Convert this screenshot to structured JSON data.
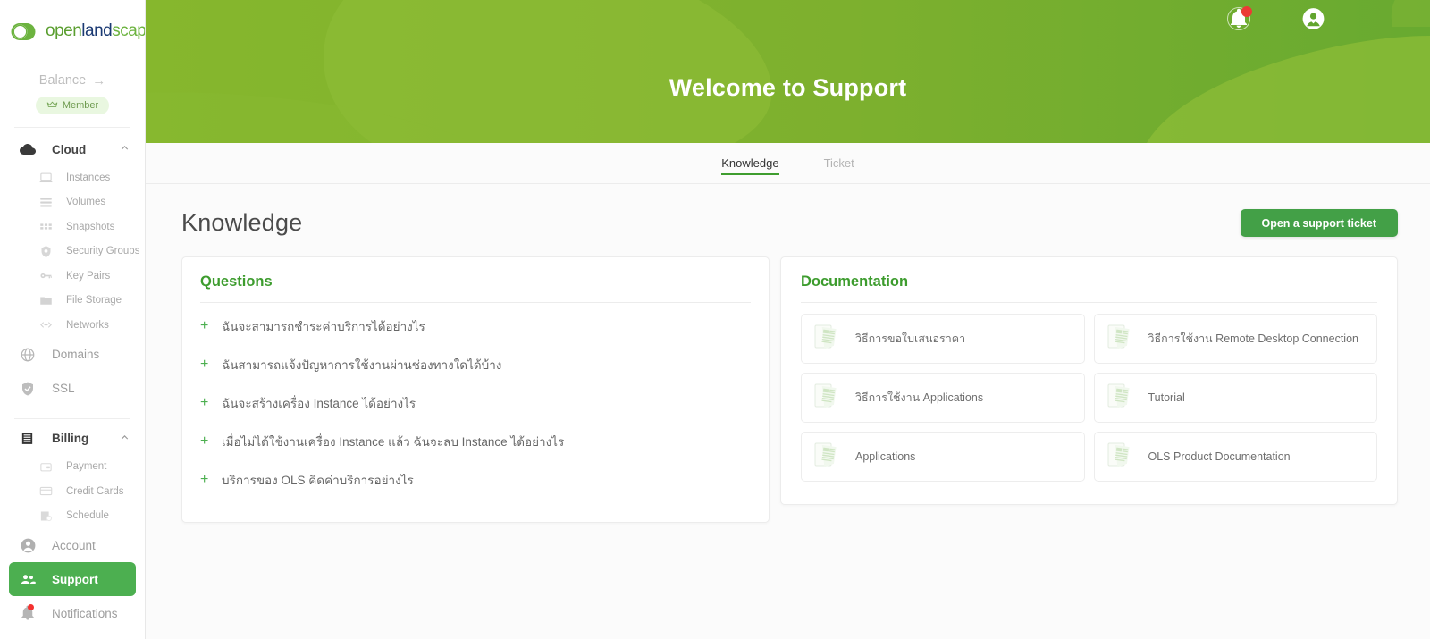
{
  "brand": {
    "logo_open": "open",
    "logo_land": "land",
    "logo_scape": "scape",
    "accent_green": "#6cb33f",
    "banner_green": "#6cab2f",
    "banner_light_green": "#8bbc33",
    "active_nav_green": "#4caf50",
    "button_green": "#43a047",
    "badge_red": "#ec3a35"
  },
  "sidebar": {
    "balance_label": "Balance",
    "balance_arrow": "→",
    "member_badge": "Member",
    "groups": [
      {
        "label": "Cloud",
        "icon": "cloud-icon",
        "expanded": true,
        "items": [
          {
            "label": "Instances",
            "icon": "laptop-icon"
          },
          {
            "label": "Volumes",
            "icon": "volumes-icon"
          },
          {
            "label": "Snapshots",
            "icon": "snapshots-icon"
          },
          {
            "label": "Security Groups",
            "icon": "shield-icon"
          },
          {
            "label": "Key Pairs",
            "icon": "key-icon"
          },
          {
            "label": "File Storage",
            "icon": "folder-icon"
          },
          {
            "label": "Networks",
            "icon": "code-brackets-icon"
          }
        ]
      }
    ],
    "links": [
      {
        "label": "Domains",
        "icon": "globe-icon"
      },
      {
        "label": "SSL",
        "icon": "shield-check-icon"
      }
    ],
    "billing": {
      "label": "Billing",
      "icon": "billing-icon",
      "expanded": true,
      "items": [
        {
          "label": "Payment",
          "icon": "wallet-icon"
        },
        {
          "label": "Credit Cards",
          "icon": "credit-card-icon"
        },
        {
          "label": "Schedule",
          "icon": "calendar-clock-icon"
        }
      ]
    },
    "bottom": [
      {
        "label": "Account",
        "icon": "account-circle-icon",
        "active": false
      },
      {
        "label": "Support",
        "icon": "people-icon",
        "active": true
      },
      {
        "label": "Notifications",
        "icon": "bell-icon",
        "active": false,
        "has_dot": true
      }
    ]
  },
  "banner": {
    "title": "Welcome to Support",
    "notifications_icon": "bell-icon",
    "avatar_icon": "account-circle-icon",
    "caret_icon": "chevron-down-icon",
    "has_notification_badge": true
  },
  "tabs": [
    {
      "label": "Knowledge",
      "active": true
    },
    {
      "label": "Ticket",
      "active": false
    }
  ],
  "page": {
    "title": "Knowledge",
    "primary_button": "Open a support ticket"
  },
  "questions": {
    "title": "Questions",
    "plus_icon": "plus-icon",
    "items": [
      {
        "text": "ฉันจะสามารถชำระค่าบริการได้อย่างไร"
      },
      {
        "text": "ฉันสามารถแจ้งปัญหาการใช้งานผ่านช่องทางใดได้บ้าง"
      },
      {
        "text": "ฉันจะสร้างเครื่อง Instance ได้อย่างไร"
      },
      {
        "text": "เมื่อไม่ได้ใช้งานเครื่อง Instance แล้ว ฉันจะลบ Instance ได้อย่างไร"
      },
      {
        "text": "บริการของ OLS คิดค่าบริการอย่างไร"
      }
    ]
  },
  "documentation": {
    "title": "Documentation",
    "doc_icon": "document-stack-icon",
    "items": [
      {
        "label": "วิธีการขอใบเสนอราคา"
      },
      {
        "label": "วิธีการใช้งาน Remote Desktop Connection"
      },
      {
        "label": "วิธีการใช้งาน Applications"
      },
      {
        "label": "Tutorial"
      },
      {
        "label": "Applications"
      },
      {
        "label": "OLS Product Documentation"
      }
    ]
  }
}
